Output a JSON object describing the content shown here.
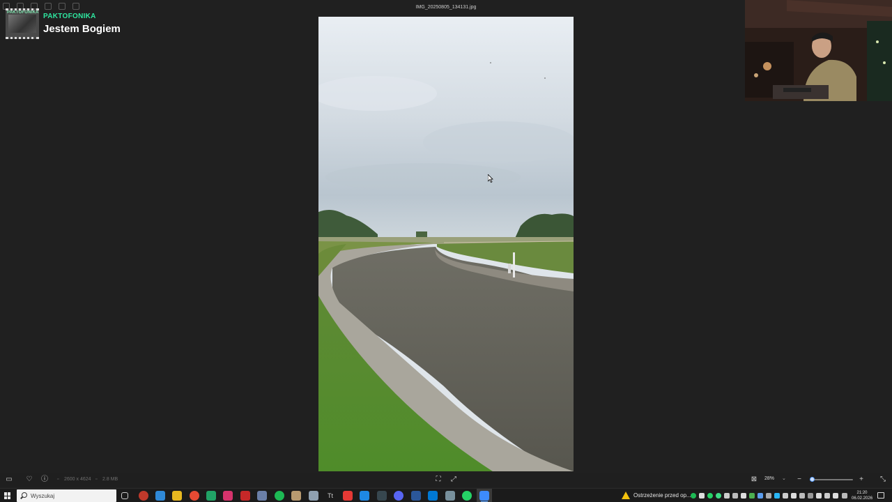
{
  "window": {
    "file_title": "IMG_20250805_134131.jpg"
  },
  "now_playing": {
    "artist": "PAKTOFONIKA",
    "track": "Jestem Bogiem",
    "art_text": "PAKTOFONIKA"
  },
  "viewer_bar": {
    "dimensions": "2600 x 4624",
    "file_size": "2.8 MB",
    "zoom": "28%",
    "zoom_fraction": 0.05
  },
  "taskbar": {
    "search_placeholder": "Wyszukaj",
    "notification_text": "Ostrzeżenie przed op...",
    "clock_time": "21:20",
    "clock_date": "06.02.2026"
  },
  "colors": {
    "artist_accent": "#2ee7a0",
    "taskbar_accent": "#60a5ff",
    "warning": "#f4c20d"
  }
}
